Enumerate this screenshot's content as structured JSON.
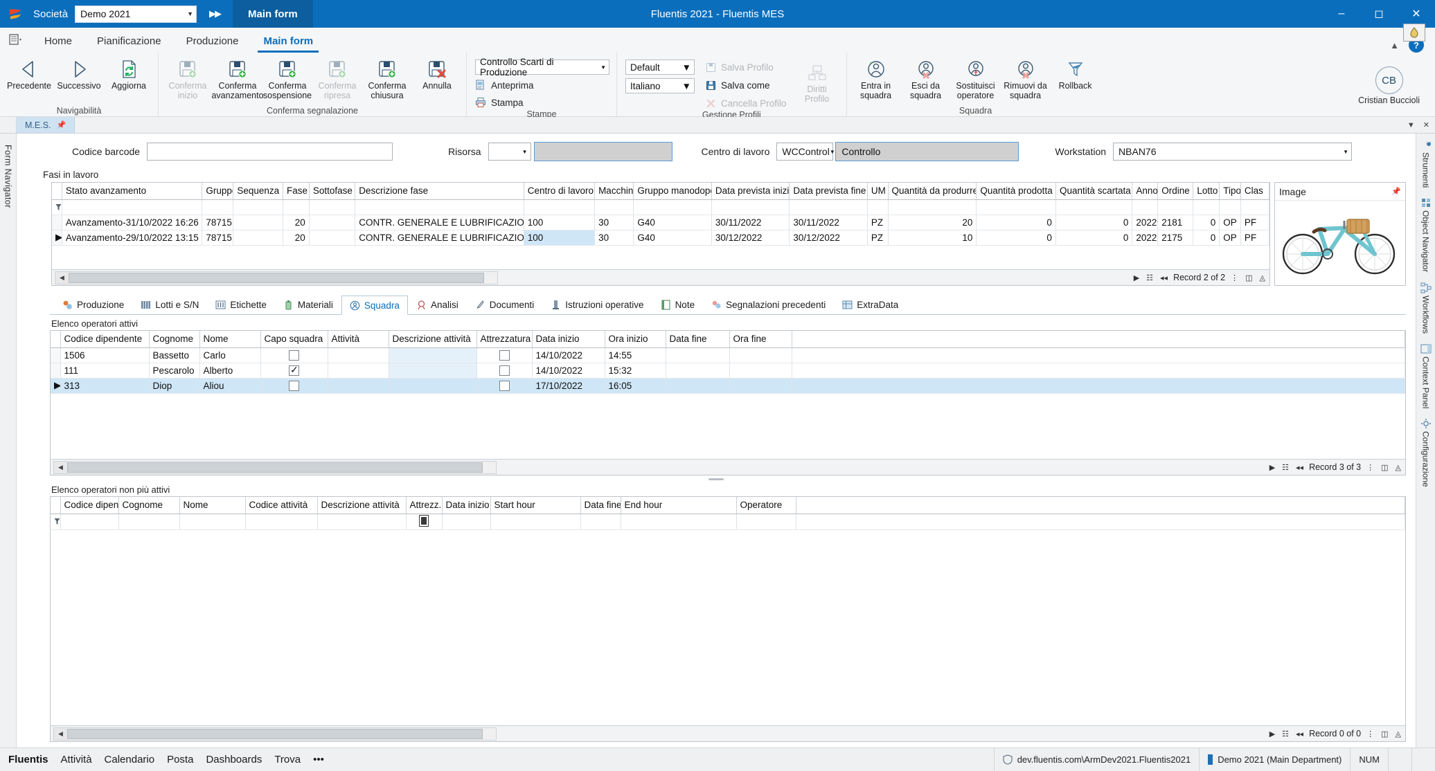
{
  "titlebar": {
    "company_label": "Società",
    "company_value": "Demo 2021",
    "expand_icon": "double-chevron-right-icon",
    "main_form_tab": "Main form",
    "window_title": "Fluentis 2021 - Fluentis MES",
    "minimize": "minimize-icon",
    "maximize": "maximize-icon",
    "close": "close-icon"
  },
  "ribbon_tabs": {
    "app_menu": "app-menu-icon",
    "tabs": [
      {
        "label": "Home",
        "active": false
      },
      {
        "label": "Pianificazione",
        "active": false
      },
      {
        "label": "Produzione",
        "active": false
      },
      {
        "label": "Main form",
        "active": true
      }
    ],
    "collapse_icon": "chevron-up-icon",
    "help_icon": "help-icon"
  },
  "ribbon": {
    "groups": [
      {
        "title": "Navigabilità",
        "buttons": [
          {
            "label1": "Precedente",
            "label2": "",
            "icon": "arrow-left-icon",
            "disabled": false
          },
          {
            "label1": "Successivo",
            "label2": "",
            "icon": "arrow-right-icon",
            "disabled": false
          },
          {
            "label1": "Aggiorna",
            "label2": "",
            "icon": "refresh-document-icon",
            "disabled": false
          }
        ]
      },
      {
        "title": "Conferma segnalazione",
        "buttons": [
          {
            "label1": "Conferma",
            "label2": "inizio",
            "icon": "save-add-icon",
            "disabled": true
          },
          {
            "label1": "Conferma",
            "label2": "avanzamento",
            "icon": "save-add-icon",
            "disabled": false
          },
          {
            "label1": "Conferma",
            "label2": "sospensione",
            "icon": "save-add-icon",
            "disabled": false
          },
          {
            "label1": "Conferma",
            "label2": "ripresa",
            "icon": "save-add-icon",
            "disabled": true
          },
          {
            "label1": "Conferma",
            "label2": "chiusura",
            "icon": "save-add-icon",
            "disabled": false
          },
          {
            "label1": "Annulla",
            "label2": "",
            "icon": "save-cancel-icon",
            "disabled": false
          }
        ]
      }
    ],
    "stampe": {
      "title": "Stampe",
      "report_value": "Controllo Scarti di Produzione",
      "preview_label": "Anteprima",
      "preview_icon": "preview-icon",
      "print_label": "Stampa",
      "print_icon": "printer-icon"
    },
    "profili": {
      "title": "Gestione Profili",
      "profile_value": "Default",
      "language_value": "Italiano",
      "save_profile": "Salva Profilo",
      "save_profile_icon": "save-icon",
      "save_as": "Salva come",
      "save_as_icon": "save-as-icon",
      "delete_profile": "Cancella Profilo",
      "delete_profile_icon": "delete-icon",
      "rights_label1": "Diritti",
      "rights_label2": "Profilo",
      "rights_icon": "rights-icon"
    },
    "squadra": {
      "title": "Squadra",
      "buttons": [
        {
          "label1": "Entra in",
          "label2": "squadra",
          "icon": "user-add-icon"
        },
        {
          "label1": "Esci da",
          "label2": "squadra",
          "icon": "user-remove-icon"
        },
        {
          "label1": "Sostituisci",
          "label2": "operatore",
          "icon": "user-replace-icon"
        },
        {
          "label1": "Rimuovi da",
          "label2": "squadra",
          "icon": "user-delete-icon"
        },
        {
          "label1": "Rollback",
          "label2": "",
          "icon": "funnel-rollback-icon"
        }
      ]
    },
    "user": {
      "initials": "CB",
      "name": "Cristian Buccioli"
    }
  },
  "form_tabs": {
    "tab_label": "M.E.S.",
    "tab_pin_icon": "pin-icon",
    "minimize_icon": "chevron-down-icon",
    "close_icon": "close-icon"
  },
  "left_rail": {
    "label": "Form Navigator"
  },
  "right_rail": {
    "items": [
      "Strumenti",
      "Object Navigator",
      "Workflows",
      "Context Panel",
      "Configurazione"
    ]
  },
  "filters": {
    "barcode_label": "Codice barcode",
    "barcode_value": "",
    "risorsa_label": "Risorsa",
    "risorsa_value": "",
    "risorsa_desc": "",
    "centro_label": "Centro di lavoro",
    "centro_value": "WCControl",
    "centro_desc": "Controllo",
    "workstation_label": "Workstation",
    "workstation_value": "NBAN76",
    "fasi_label": "Fasi in lavoro",
    "legend_icon": "legend-icon"
  },
  "main_grid": {
    "columns": [
      "Stato avanzamento",
      "Gruppo",
      "Sequenza",
      "Fase",
      "Sottofase",
      "Descrizione fase",
      "Centro di lavoro",
      "Macchina",
      "Gruppo manodopera",
      "Data prevista inizio",
      "Data prevista fine",
      "UM",
      "Quantità da produrre",
      "Quantità prodotta",
      "Quantità scartata",
      "Anno",
      "Ordine",
      "Lotto",
      "Tipo",
      "Clas"
    ],
    "rows": [
      {
        "selected": false,
        "cells": [
          "Avanzamento-31/10/2022 16:26",
          "78715",
          "",
          "20",
          "",
          "CONTR. GENERALE  E LUBRIFICAZIONE",
          "100",
          "30",
          "G40",
          "30/11/2022",
          "30/11/2022",
          "PZ",
          "20",
          "0",
          "0",
          "2022",
          "2181",
          "0",
          "OP",
          "PF"
        ]
      },
      {
        "selected": true,
        "cells": [
          "Avanzamento-29/10/2022 13:15",
          "78715",
          "",
          "20",
          "",
          "CONTR. GENERALE  E LUBRIFICAZIONE",
          "100",
          "30",
          "G40",
          "30/12/2022",
          "30/12/2022",
          "PZ",
          "10",
          "0",
          "0",
          "2022",
          "2175",
          "0",
          "OP",
          "PF"
        ]
      }
    ],
    "record_status": "Record 2 of 2"
  },
  "image_panel": {
    "title": "Image",
    "pin_icon": "pin-icon",
    "image": "bicycle-photo"
  },
  "section_tabs": [
    {
      "label": "Produzione",
      "icon": "production-icon",
      "active": false
    },
    {
      "label": "Lotti e S/N",
      "icon": "lots-icon",
      "active": false
    },
    {
      "label": "Etichette",
      "icon": "labels-icon",
      "active": false
    },
    {
      "label": "Materiali",
      "icon": "materials-icon",
      "active": false
    },
    {
      "label": "Squadra",
      "icon": "team-icon",
      "active": true
    },
    {
      "label": "Analisi",
      "icon": "analysis-icon",
      "active": false
    },
    {
      "label": "Documenti",
      "icon": "documents-icon",
      "active": false
    },
    {
      "label": "Istruzioni operative",
      "icon": "instructions-icon",
      "active": false
    },
    {
      "label": "Note",
      "icon": "notes-icon",
      "active": false
    },
    {
      "label": "Segnalazioni precedenti",
      "icon": "previous-reports-icon",
      "active": false
    },
    {
      "label": "ExtraData",
      "icon": "extradata-icon",
      "active": false
    }
  ],
  "active_operators": {
    "caption": "Elenco operatori attivi",
    "columns": [
      "Codice dipendente",
      "Cognome",
      "Nome",
      "Capo squadra",
      "Attività",
      "Descrizione attività",
      "Attrezzatura",
      "Data inizio",
      "Ora inizio",
      "Data fine",
      "Ora fine"
    ],
    "rows": [
      {
        "selected": false,
        "codice": "1506",
        "cognome": "Bassetto",
        "nome": "Carlo",
        "capo_squadra": false,
        "attivita": "",
        "descrizione": "",
        "attrezzatura": false,
        "data_inizio": "14/10/2022",
        "ora_inizio": "14:55",
        "data_fine": "",
        "ora_fine": ""
      },
      {
        "selected": false,
        "codice": "111",
        "cognome": "Pescarolo",
        "nome": "Alberto",
        "capo_squadra": true,
        "attivita": "",
        "descrizione": "",
        "attrezzatura": false,
        "data_inizio": "14/10/2022",
        "ora_inizio": "15:32",
        "data_fine": "",
        "ora_fine": ""
      },
      {
        "selected": true,
        "codice": "313",
        "cognome": "Diop",
        "nome": "Aliou",
        "capo_squadra": false,
        "attivita": "",
        "descrizione": "",
        "attrezzatura": false,
        "data_inizio": "17/10/2022",
        "ora_inizio": "16:05",
        "data_fine": "",
        "ora_fine": ""
      }
    ],
    "record_status": "Record 3 of 3"
  },
  "inactive_operators": {
    "caption": "Elenco operatori non più attivi",
    "columns": [
      "Codice dipen...",
      "Cognome",
      "Nome",
      "Codice attività",
      "Descrizione attività",
      "Attrezz.",
      "Data inizio",
      "Start hour",
      "Data fine",
      "End hour",
      "Operatore"
    ],
    "rows": [],
    "record_status": "Record 0 of 0"
  },
  "statusbar": {
    "left_items": [
      "Fluentis",
      "Attività",
      "Calendario",
      "Posta",
      "Dashboards",
      "Trova",
      "•••"
    ],
    "connection": "dev.fluentis.com\\ArmDev2021.Fluentis2021",
    "connection_icon": "shield-icon",
    "database": "Demo 2021 (Main Department)",
    "database_icon": "database-icon",
    "num_indicator": "NUM"
  }
}
